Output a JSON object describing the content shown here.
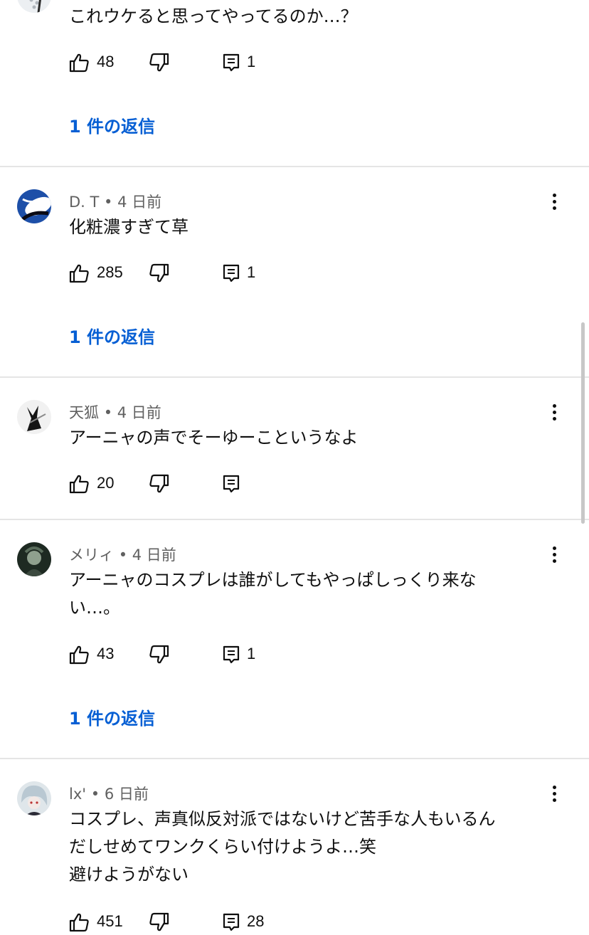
{
  "comments": [
    {
      "author": "",
      "age": "",
      "lines": [
        "これウケると思ってやってるのか…？"
      ],
      "likes": "48",
      "reply_count": "1",
      "replies_link": "1 件の返信"
    },
    {
      "author": "D. T",
      "age": "4 日前",
      "lines": [
        "化粧濃すぎて草"
      ],
      "likes": "285",
      "reply_count": "1",
      "replies_link": "1 件の返信"
    },
    {
      "author": "天狐",
      "age": "4 日前",
      "lines": [
        "アーニャの声でそーゆーこというなよ"
      ],
      "likes": "20",
      "reply_count": "",
      "replies_link": ""
    },
    {
      "author": "メリィ",
      "age": "4 日前",
      "lines": [
        "アーニャのコスプレは誰がしてもやっぱしっくり来な",
        "い…。"
      ],
      "likes": "43",
      "reply_count": "1",
      "replies_link": "1 件の返信"
    },
    {
      "author": "lx'",
      "age": "6 日前",
      "lines": [
        "コスプレ、声真似反対派ではないけど苦手な人もいるん",
        "だしせめてワンクくらい付けようよ…笑",
        "避けようがない"
      ],
      "likes": "451",
      "reply_count": "28",
      "replies_link": ""
    }
  ],
  "separator": "•",
  "icons": {
    "like": "thumb-up-icon",
    "dislike": "thumb-down-icon",
    "reply": "comment-reply-icon",
    "menu": "more-vert-icon"
  },
  "colors": {
    "link": "#065fd4",
    "meta": "#606060",
    "text": "#0f0f0f",
    "divider": "#e5e5e5"
  }
}
